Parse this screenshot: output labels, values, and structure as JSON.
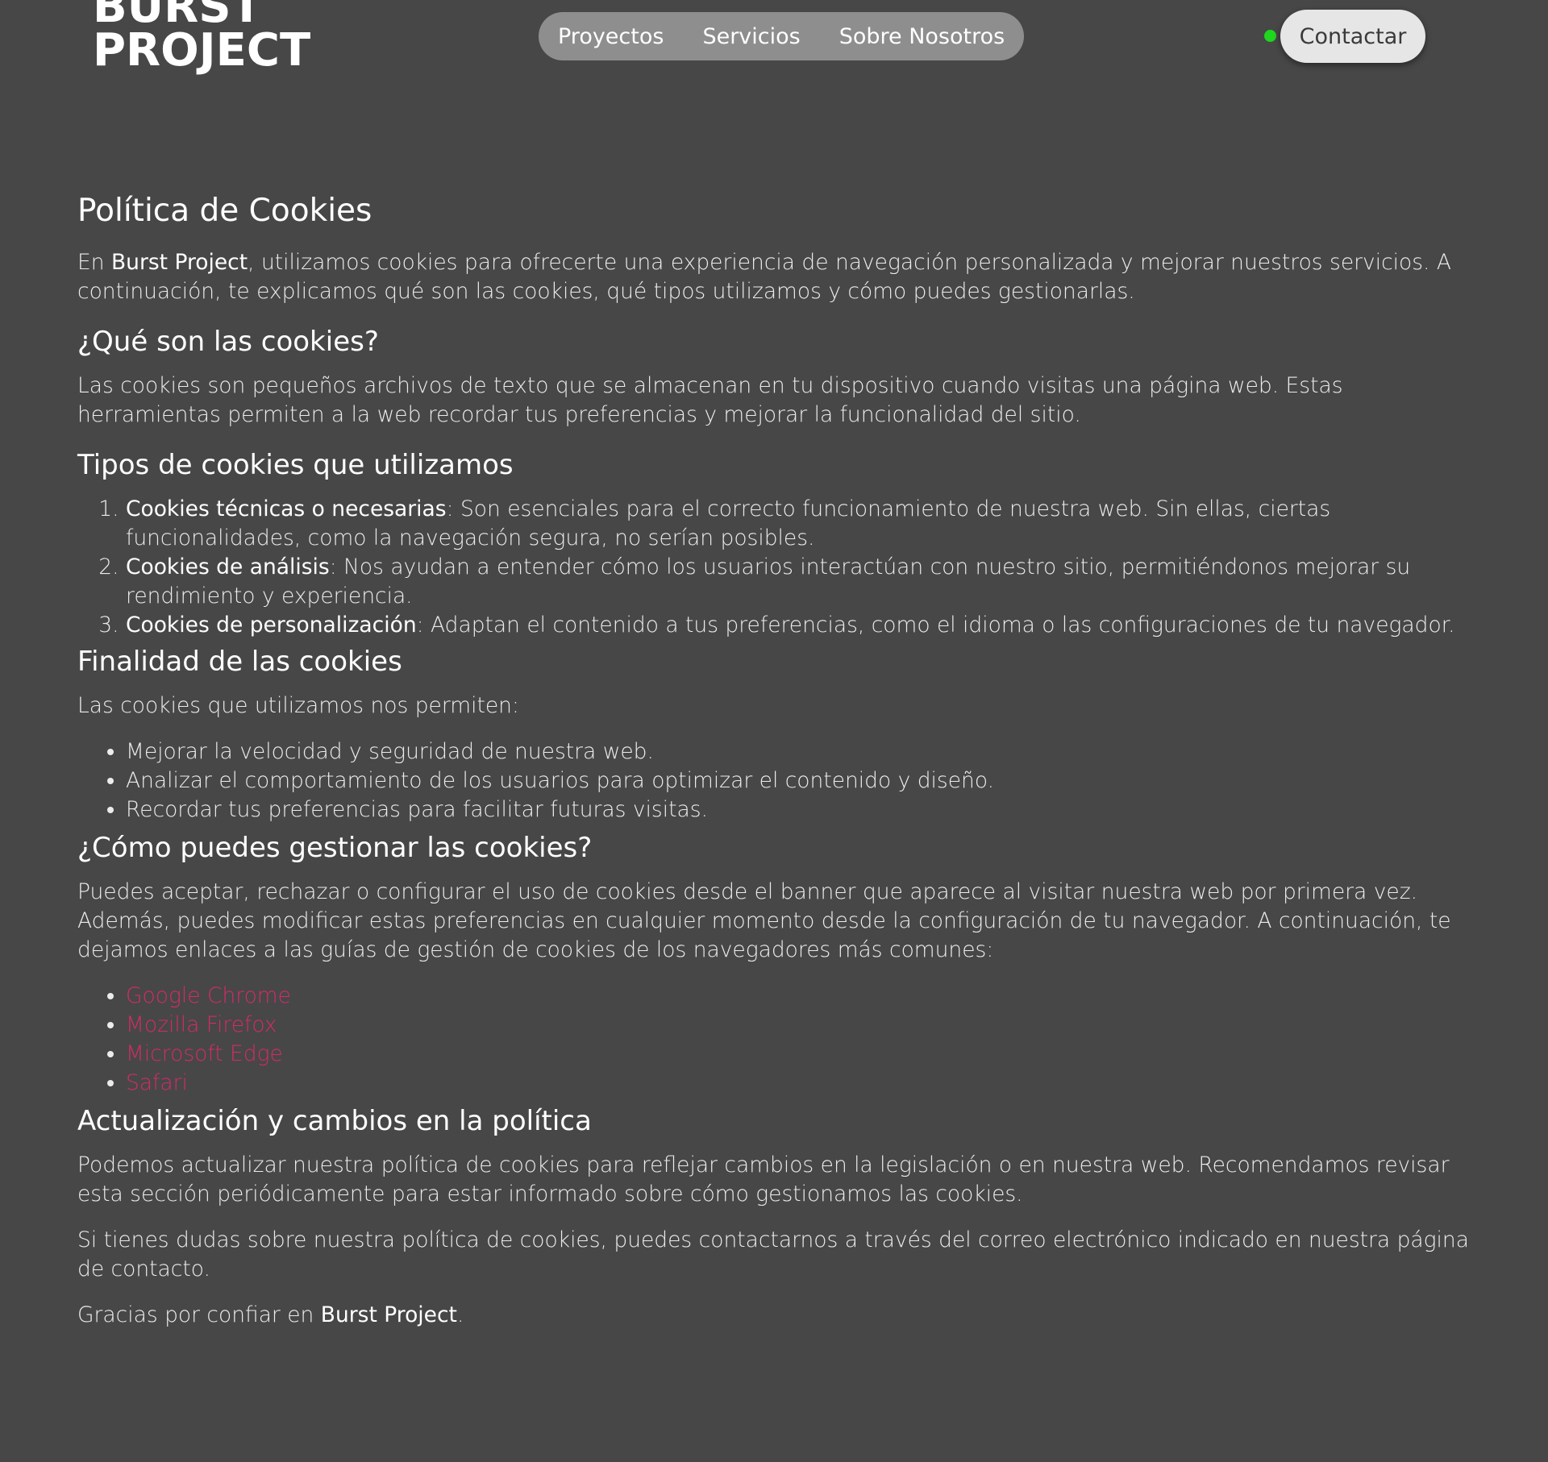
{
  "header": {
    "logo_line1": "BURST",
    "logo_line2": "PROJECT",
    "nav": [
      "Proyectos",
      "Servicios",
      "Sobre Nosotros"
    ],
    "contact_label": "Contactar",
    "status_color": "#1fd61f"
  },
  "page": {
    "title": "Política de Cookies",
    "intro_pre": "En ",
    "brand": "Burst Project",
    "intro_post": ", utilizamos cookies para ofrecerte una experiencia de navegación personalizada y mejorar nuestros servicios. A continuación, te explicamos qué son las cookies, qué tipos utilizamos y cómo puedes gestionarlas.",
    "s1_title": "¿Qué son las cookies?",
    "s1_text": "Las cookies son pequeños archivos de texto que se almacenan en tu dispositivo cuando visitas una página web. Estas herramientas permiten a la web recordar tus preferencias y mejorar la funcionalidad del sitio.",
    "s2_title": "Tipos de cookies que utilizamos",
    "types": [
      {
        "label": "Cookies técnicas o necesarias",
        "text": ": Son esenciales para el correcto funcionamiento de nuestra web. Sin ellas, ciertas funcionalidades, como la navegación segura, no serían posibles."
      },
      {
        "label": "Cookies de análisis",
        "text": ": Nos ayudan a entender cómo los usuarios interactúan con nuestro sitio, permitiéndonos mejorar su rendimiento y experiencia."
      },
      {
        "label": "Cookies de personalización",
        "text": ": Adaptan el contenido a tus preferencias, como el idioma o las configuraciones de tu navegador."
      }
    ],
    "s3_title": "Finalidad de las cookies",
    "s3_text": "Las cookies que utilizamos nos permiten:",
    "purposes": [
      "Mejorar la velocidad y seguridad de nuestra web.",
      "Analizar el comportamiento de los usuarios para optimizar el contenido y diseño.",
      "Recordar tus preferencias para facilitar futuras visitas."
    ],
    "s4_title": "¿Cómo puedes gestionar las cookies?",
    "s4_text": "Puedes aceptar, rechazar o configurar el uso de cookies desde el banner que aparece al visitar nuestra web por primera vez. Además, puedes modificar estas preferencias en cualquier momento desde la configuración de tu navegador. A continuación, te dejamos enlaces a las guías de gestión de cookies de los navegadores más comunes:",
    "browsers": [
      "Google Chrome",
      "Mozilla Firefox",
      "Microsoft Edge",
      "Safari"
    ],
    "link_color": "#d42b67",
    "s5_title": "Actualización y cambios en la política",
    "s5_text": "Podemos actualizar nuestra política de cookies para reflejar cambios en la legislación o en nuestra web. Recomendamos revisar esta sección periódicamente para estar informado sobre cómo gestionamos las cookies.",
    "s5_text2": "Si tienes dudas sobre nuestra política de cookies, puedes contactarnos a través del correo electrónico indicado en nuestra página de contacto.",
    "thanks_pre": "Gracias por confiar en ",
    "thanks_brand": "Burst Project",
    "thanks_post": "."
  }
}
